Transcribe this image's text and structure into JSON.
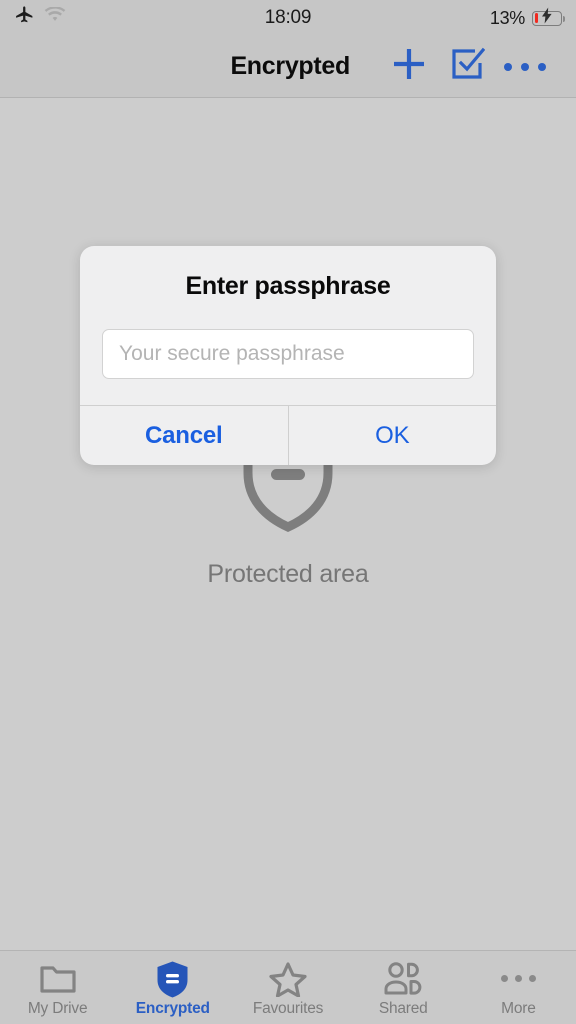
{
  "status_bar": {
    "airplane_icon": "airplane-mode-icon",
    "wifi_icon": "wifi-icon",
    "time": "18:09",
    "battery_percent": "13%",
    "battery_level": 13,
    "charging": true
  },
  "nav_bar": {
    "title": "Encrypted",
    "add_icon": "plus-icon",
    "select_icon": "checkbox-select-icon",
    "more_icon": "more-horizontal-icon",
    "accent_color": "#2b5fc4"
  },
  "content": {
    "shield_icon": "shield-outline-icon",
    "empty_label": "Protected area"
  },
  "dialog": {
    "title": "Enter passphrase",
    "input_value": "",
    "input_placeholder": "Your secure passphrase",
    "cancel_label": "Cancel",
    "ok_label": "OK",
    "button_color": "#1a5fe0"
  },
  "tab_bar": {
    "items": [
      {
        "label": "My Drive",
        "icon": "folder-icon",
        "active": false
      },
      {
        "label": "Encrypted",
        "icon": "shield-icon",
        "active": true
      },
      {
        "label": "Favourites",
        "icon": "star-icon",
        "active": false
      },
      {
        "label": "Shared",
        "icon": "people-icon",
        "active": false
      },
      {
        "label": "More",
        "icon": "more-horizontal-icon",
        "active": false
      }
    ],
    "active_color": "#2b5fc4",
    "inactive_color": "#7c7c7c"
  }
}
